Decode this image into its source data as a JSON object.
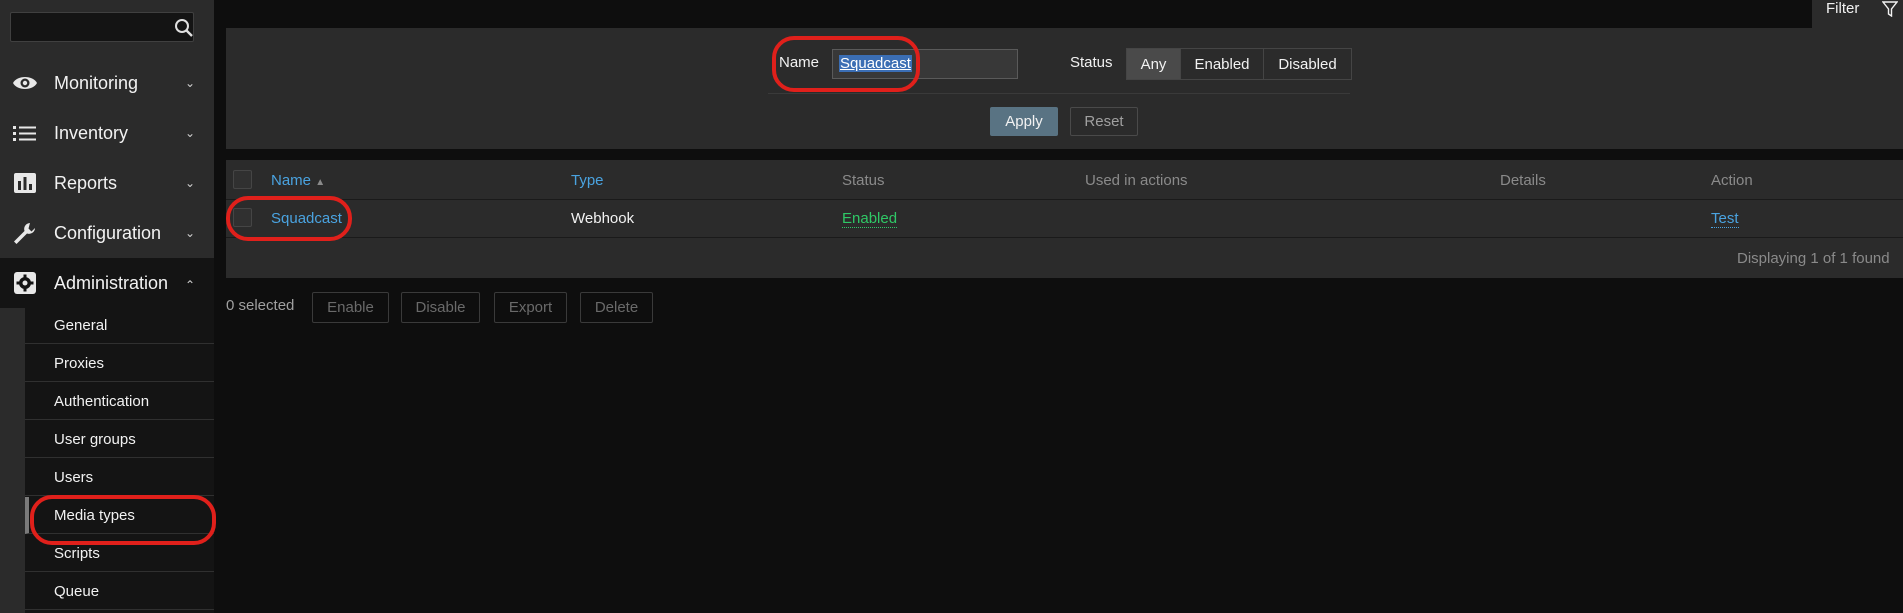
{
  "sidebar": {
    "search": {
      "value": ""
    },
    "items": [
      {
        "label": "Monitoring",
        "icon": "eye-icon",
        "expanded": false
      },
      {
        "label": "Inventory",
        "icon": "list-icon",
        "expanded": false
      },
      {
        "label": "Reports",
        "icon": "bar-chart-icon",
        "expanded": false
      },
      {
        "label": "Configuration",
        "icon": "wrench-icon",
        "expanded": false
      },
      {
        "label": "Administration",
        "icon": "gear-icon",
        "expanded": true
      }
    ],
    "submenu": [
      "General",
      "Proxies",
      "Authentication",
      "User groups",
      "Users",
      "Media types",
      "Scripts",
      "Queue"
    ],
    "selected_submenu": "Media types"
  },
  "filter": {
    "tab_label": "Filter",
    "name_label": "Name",
    "name_value": "Squadcast",
    "status_label": "Status",
    "status_options": [
      "Any",
      "Enabled",
      "Disabled"
    ],
    "status_selected": "Any",
    "apply_label": "Apply",
    "reset_label": "Reset"
  },
  "table": {
    "headers": [
      "Name",
      "Type",
      "Status",
      "Used in actions",
      "Details",
      "Action"
    ],
    "sort_indicator": "▲",
    "rows": [
      {
        "name": "Squadcast",
        "type": "Webhook",
        "status": "Enabled",
        "used_in_actions": "",
        "details": "",
        "action": "Test"
      }
    ],
    "footer": "Displaying 1 of 1 found"
  },
  "actions": {
    "selected_count": "0 selected",
    "buttons": [
      "Enable",
      "Disable",
      "Export",
      "Delete"
    ]
  },
  "colors": {
    "accent_link": "#4aa3e0",
    "status_enabled": "#2fc866",
    "highlight": "#e0201b",
    "apply_button": "#597383"
  }
}
